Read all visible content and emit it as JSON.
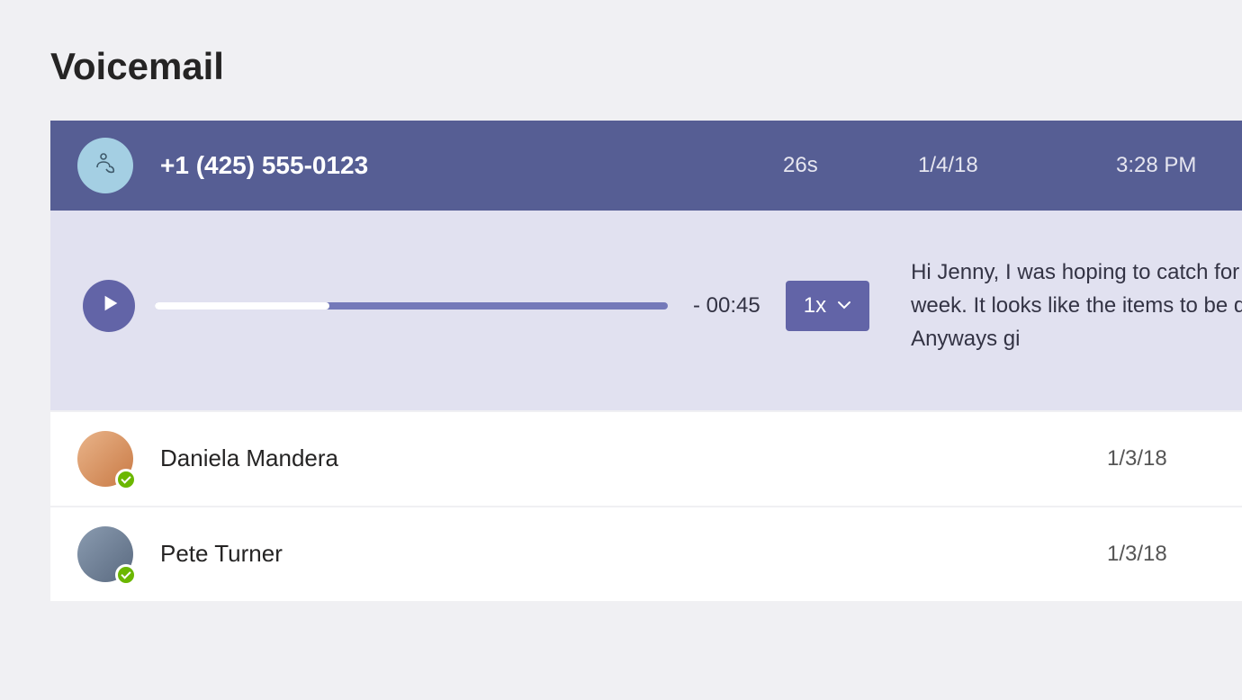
{
  "page": {
    "title": "Voicemail"
  },
  "selected": {
    "caller": "+1 (425) 555-0123",
    "duration": "26s",
    "date": "1/4/18",
    "time": "3:28 PM",
    "player": {
      "remaining": "- 00:45",
      "speed_label": "1x",
      "transcript": "Hi Jenny, I was hoping to catch for next week. It looks like the items to be done. Anyways gi"
    }
  },
  "items": [
    {
      "name": "Daniela Mandera",
      "date": "1/3/18"
    },
    {
      "name": "Pete Turner",
      "date": "1/3/18"
    }
  ]
}
